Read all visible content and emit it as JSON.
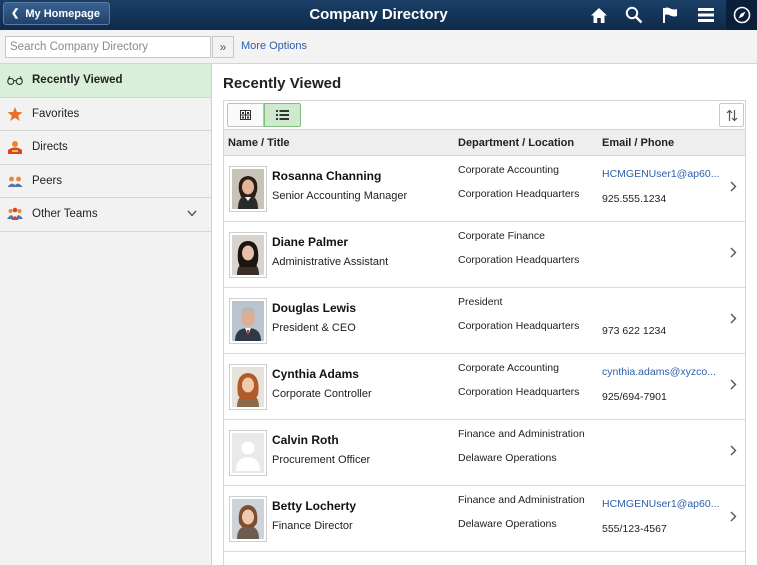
{
  "header": {
    "home_label": "My Homepage",
    "title": "Company Directory"
  },
  "search": {
    "placeholder": "Search Company Directory",
    "go_label": "»",
    "more_options": "More Options"
  },
  "sidebar": {
    "items": [
      {
        "label": "Recently Viewed",
        "icon": "glasses-icon",
        "active": true
      },
      {
        "label": "Favorites",
        "icon": "star-icon",
        "active": false
      },
      {
        "label": "Directs",
        "icon": "directs-icon",
        "active": false
      },
      {
        "label": "Peers",
        "icon": "peers-icon",
        "active": false
      },
      {
        "label": "Other Teams",
        "icon": "teams-icon",
        "active": false
      }
    ]
  },
  "main": {
    "section_title": "Recently Viewed",
    "columns": [
      "Name / Title",
      "Department / Location",
      "Email / Phone"
    ],
    "rows": [
      {
        "name": "Rosanna Channing",
        "title": "Senior Accounting Manager",
        "dept": "Corporate Accounting",
        "location": "Corporation Headquarters",
        "email": "HCMGENUser1@ap60...",
        "phone": "925.555.1234",
        "photo": "woman-dark-hair"
      },
      {
        "name": "Diane Palmer",
        "title": "Administrative Assistant",
        "dept": "Corporate Finance",
        "location": "Corporation Headquarters",
        "email": "",
        "phone": "",
        "photo": "woman-dark-hair"
      },
      {
        "name": "Douglas Lewis",
        "title": "President & CEO",
        "dept": "President",
        "location": "Corporation Headquarters",
        "email": "",
        "phone": "973 622 1234",
        "photo": "man-grey-hair"
      },
      {
        "name": "Cynthia Adams",
        "title": "Corporate Controller",
        "dept": "Corporate Accounting",
        "location": "Corporation Headquarters",
        "email": "cynthia.adams@xyzco...",
        "phone": "925/694-7901",
        "photo": "woman-red-hair"
      },
      {
        "name": "Calvin Roth",
        "title": "Procurement Officer",
        "dept": "Finance and Administration",
        "location": "Delaware Operations",
        "email": "",
        "phone": "",
        "photo": "placeholder"
      },
      {
        "name": "Betty Locherty",
        "title": "Finance Director",
        "dept": "Finance and Administration",
        "location": "Delaware Operations",
        "email": "HCMGENUser1@ap60...",
        "phone": "555/123-4567",
        "photo": "woman-brown-hair"
      }
    ]
  },
  "colors": {
    "header": "#143459",
    "active_sidebar": "#d9efd9",
    "link": "#2d5eaa"
  }
}
